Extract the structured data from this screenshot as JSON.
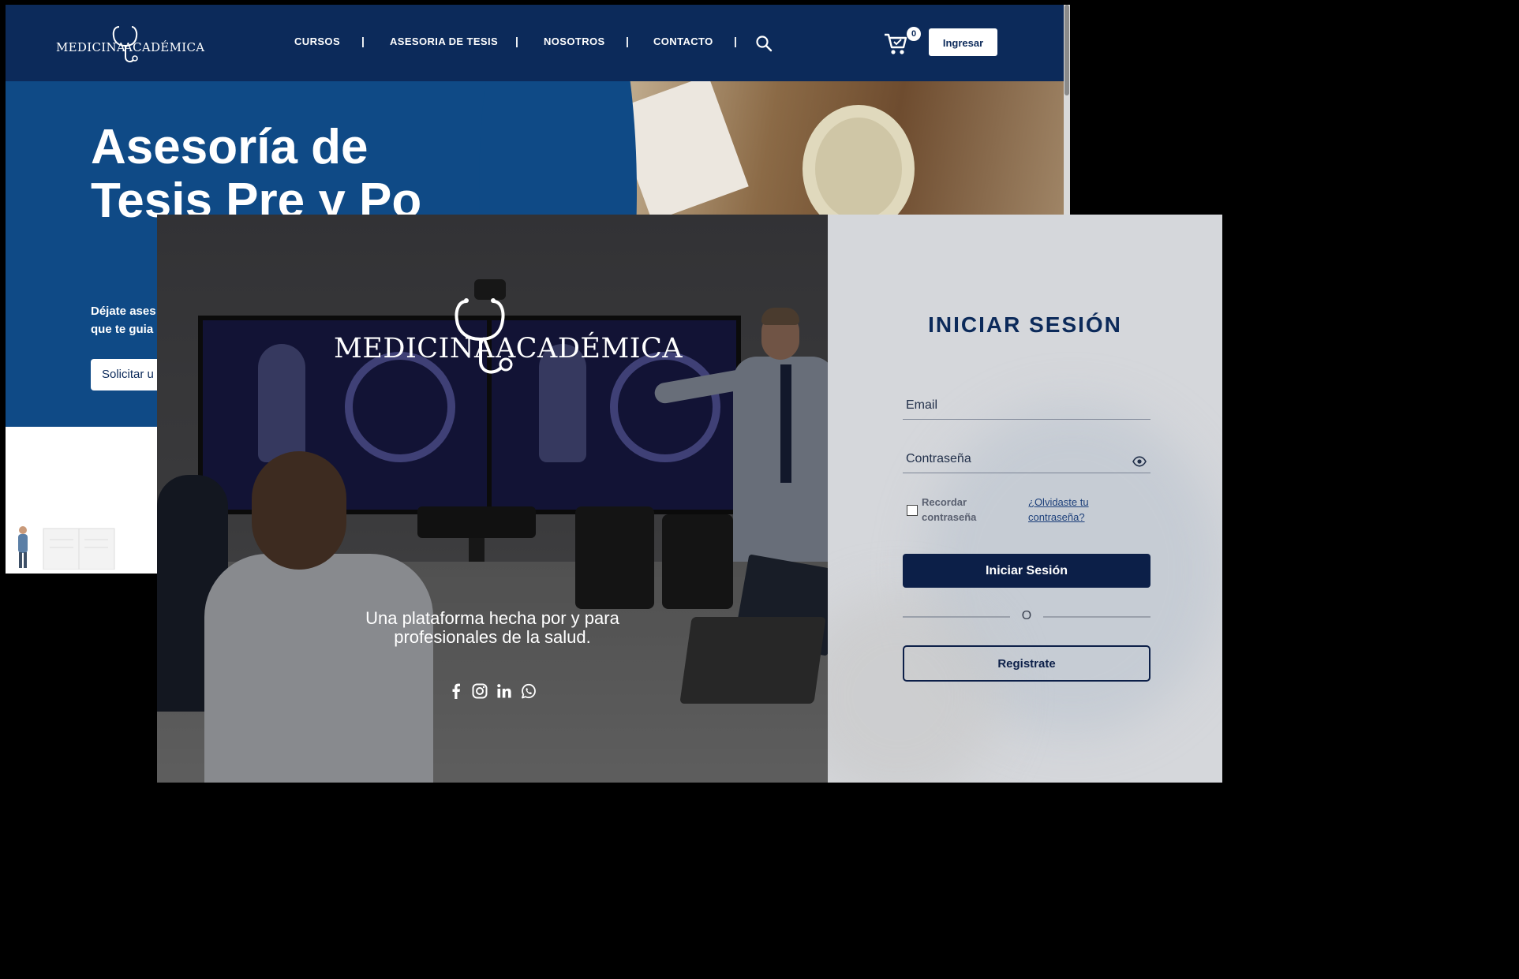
{
  "site": {
    "logo": {
      "word1": "MEDICINA",
      "word2": "ACADÉMICA"
    },
    "nav": [
      {
        "label": "CURSOS"
      },
      {
        "label": "ASESORIA DE TESIS"
      },
      {
        "label": "NOSOTROS"
      },
      {
        "label": "CONTACTO"
      }
    ],
    "nav_separator": "|",
    "cart_count": "0",
    "login_button": "Ingresar",
    "hero": {
      "title_visible": "Asesoría de Tesis Pre y Po",
      "subtitle_line1": "Déjate ases",
      "subtitle_line2": "que te guia",
      "cta_visible": "Solicitar u"
    },
    "colors": {
      "navbar": "#0c2a5a",
      "hero": "#0f4a86"
    }
  },
  "login": {
    "logo": {
      "word1": "MEDICINA",
      "word2": "ACADÉMICA"
    },
    "tagline_line1": "Una plataforma hecha por y para",
    "tagline_line2": "profesionales de la salud.",
    "social_icons": [
      "facebook-icon",
      "instagram-icon",
      "linkedin-icon",
      "whatsapp-icon"
    ],
    "title": "INICIAR SESIÓN",
    "email_placeholder": "Email",
    "password_placeholder": "Contraseña",
    "remember_label": "Recordar contraseña",
    "forgot_link": "¿Olvidaste tu contraseña?",
    "submit_label": "Iniciar Sesión",
    "divider_text": "O",
    "register_label": "Registrate",
    "colors": {
      "primary": "#0c1f48",
      "panel": "#d5d7db"
    }
  }
}
